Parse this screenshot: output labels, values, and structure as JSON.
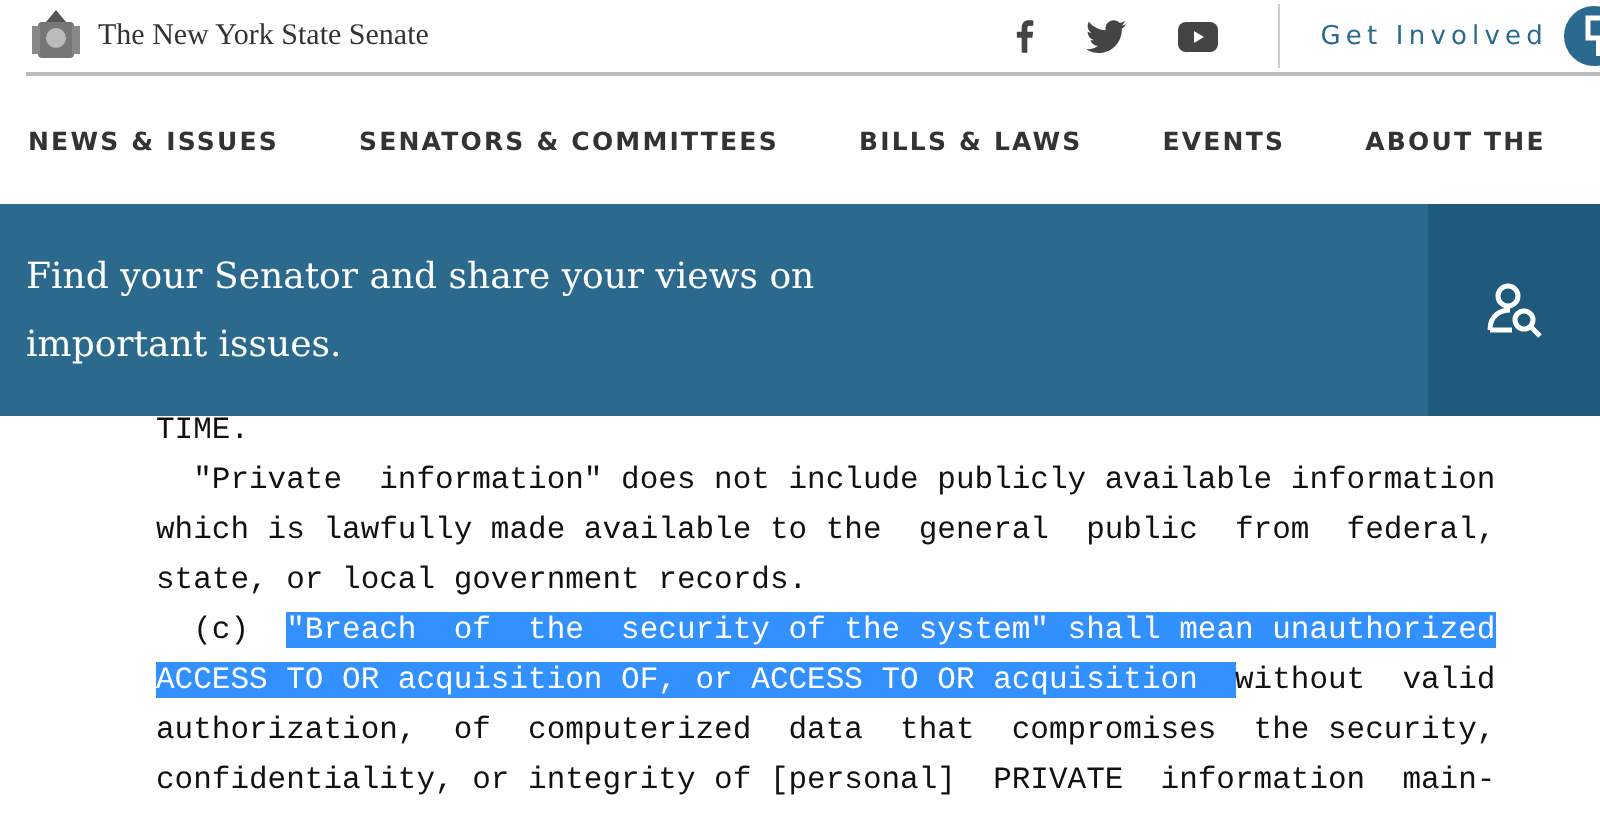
{
  "header": {
    "site_title": "The New York State Senate",
    "get_involved": "Get Involved"
  },
  "nav": [
    "NEWS & ISSUES",
    "SENATORS & COMMITTEES",
    "BILLS & LAWS",
    "EVENTS",
    "ABOUT THE"
  ],
  "banner": {
    "text": "Find your Senator and share your views on important issues."
  },
  "document": {
    "lines": [
      [
        {
          "text": "TIME.",
          "selected": false
        }
      ],
      [
        {
          "text": "  \"Private  information\" does not include publicly available information",
          "selected": false
        }
      ],
      [
        {
          "text": "which is lawfully made available to the  general  public  from  federal,",
          "selected": false
        }
      ],
      [
        {
          "text": "state, or local government records.",
          "selected": false
        }
      ],
      [
        {
          "text": "  (c)  ",
          "selected": false
        },
        {
          "text": "\"Breach  of  the  security of the system\" shall mean unauthorized",
          "selected": true
        }
      ],
      [
        {
          "text": "ACCESS TO OR acquisition OF, or ACCESS TO OR acquisition  ",
          "selected": true
        },
        {
          "text": "without  valid",
          "selected": false
        }
      ],
      [
        {
          "text": "authorization,  of  computerized  data  that  compromises  the security,",
          "selected": false
        }
      ],
      [
        {
          "text": "confidentiality, or integrity of [personal]  PRIVATE  information  main-",
          "selected": false
        }
      ]
    ]
  }
}
